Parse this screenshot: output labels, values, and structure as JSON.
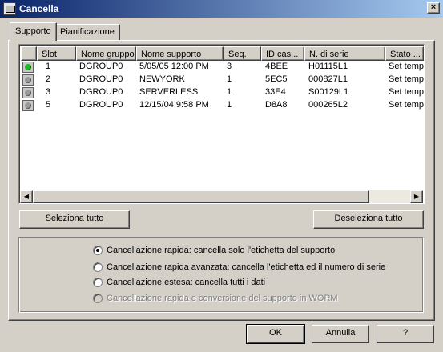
{
  "window": {
    "title": "Cancella",
    "close_glyph": "×",
    "icon": "app-window-icon"
  },
  "tabs": [
    {
      "label": "Supporto",
      "active": true
    },
    {
      "label": "Pianificazione",
      "active": false
    }
  ],
  "table": {
    "columns": [
      "",
      "Slot",
      "Nome gruppo",
      "Nome supporto",
      "Seq.",
      "ID cas...",
      "N. di serie",
      "Stato ..."
    ],
    "rows": [
      {
        "status": "green",
        "slot": "1",
        "group": "DGROUP0",
        "media": "5/05/05 12:00 PM",
        "seq": "3",
        "id": "4BEE",
        "serial": "H01115L1",
        "state": "Set tempo"
      },
      {
        "status": "gray",
        "slot": "2",
        "group": "DGROUP0",
        "media": "NEWYORK",
        "seq": "1",
        "id": "5EC5",
        "serial": "000827L1",
        "state": "Set tempo"
      },
      {
        "status": "gray",
        "slot": "3",
        "group": "DGROUP0",
        "media": "SERVERLESS",
        "seq": "1",
        "id": "33E4",
        "serial": "S00129L1",
        "state": "Set tempo"
      },
      {
        "status": "gray",
        "slot": "5",
        "group": "DGROUP0",
        "media": "12/15/04 9:58 PM",
        "seq": "1",
        "id": "D8A8",
        "serial": "000265L2",
        "state": "Set tempo"
      }
    ]
  },
  "buttons": {
    "select_all": "Seleziona tutto",
    "deselect_all": "Deseleziona tutto",
    "ok": "OK",
    "cancel": "Annulla",
    "help": "?"
  },
  "options": [
    {
      "label": "Cancellazione rapida: cancella solo l'etichetta del supporto",
      "checked": true,
      "disabled": false
    },
    {
      "label": "Cancellazione rapida avanzata: cancella l'etichetta ed il numero di serie",
      "checked": false,
      "disabled": false
    },
    {
      "label": "Cancellazione estesa: cancella tutti i dati",
      "checked": false,
      "disabled": false
    },
    {
      "label": "Cancellazione rapida e conversione del supporto in WORM",
      "checked": false,
      "disabled": true
    }
  ],
  "colors": {
    "status_green": "#22b822",
    "status_gray": "#9a9a9a",
    "titlebar_start": "#0a246a",
    "titlebar_end": "#a6caf0"
  }
}
